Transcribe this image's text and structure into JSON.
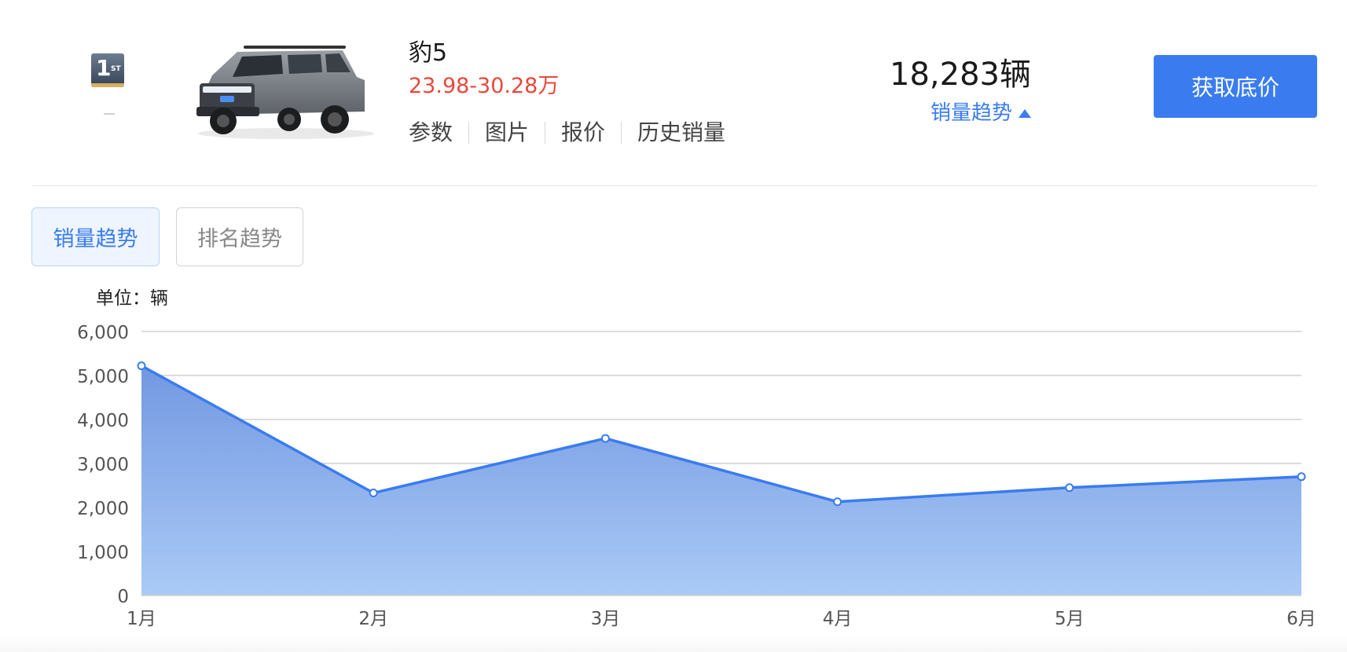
{
  "header": {
    "rank": "1",
    "rank_suffix": "ST",
    "rank_change": "",
    "car_image_icon": "suv-car-image",
    "car_name": "豹5",
    "price_range": "23.98-30.28万",
    "links": [
      "参数",
      "图片",
      "报价",
      "历史销量"
    ],
    "sales_count": "18,283辆",
    "sales_trend_label": "销量趋势",
    "cta_label": "获取底价"
  },
  "tabs": [
    {
      "label": "销量趋势",
      "active": true
    },
    {
      "label": "排名趋势",
      "active": false
    }
  ],
  "chart_unit_label": "单位：辆",
  "colors": {
    "accent": "#3a7cf0",
    "price": "#e8483c",
    "area_top": "#6b93e0",
    "area_bottom": "#a6c7f5"
  },
  "chart_data": {
    "type": "area",
    "categories": [
      "1月",
      "2月",
      "3月",
      "4月",
      "5月",
      "6月"
    ],
    "values": [
      5220,
      2330,
      3570,
      2130,
      2450,
      2700
    ],
    "ylim": [
      0,
      6000
    ],
    "yticks": [
      0,
      1000,
      2000,
      3000,
      4000,
      5000,
      6000
    ],
    "ytick_labels": [
      "0",
      "1,000",
      "2,000",
      "3,000",
      "4,000",
      "5,000",
      "6,000"
    ],
    "ylabel": "单位：辆",
    "grid": true,
    "legend": "none"
  }
}
